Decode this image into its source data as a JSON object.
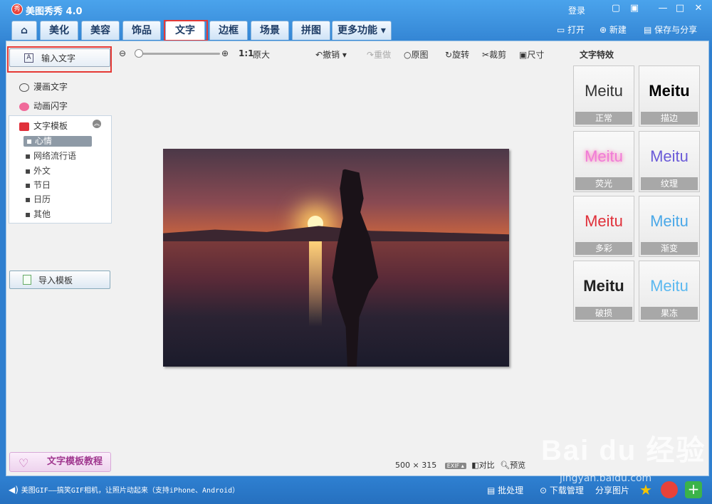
{
  "titlebar": {
    "app_title": "美图秀秀 4.0",
    "logo_glyph": "秀",
    "login": "登录",
    "msg_icon": "message-icon",
    "skin_icon": "skin-icon",
    "min_glyph": "—",
    "max_glyph": "□",
    "close_glyph": "✕"
  },
  "tabs": [
    "美化",
    "美容",
    "饰品",
    "文字",
    "边框",
    "场景",
    "拼图",
    "更多功能"
  ],
  "active_tab": "文字",
  "right_actions": {
    "open": "打开",
    "new": "新建",
    "save": "保存与分享"
  },
  "left_panel": {
    "input_text": "输入文字",
    "input_icon_glyph": "A",
    "comic_text": "漫画文字",
    "anim_text": "动画闪字",
    "template_header": "文字模板",
    "template_items": [
      "心情",
      "网络流行语",
      "外文",
      "节日",
      "日历",
      "其他"
    ],
    "import_template": "导入模板",
    "tutorial": "文字模板教程"
  },
  "toolbar": {
    "ratio": "1:1",
    "original_size": "原大",
    "undo": "撤销",
    "redo": "重做",
    "original": "原图",
    "rotate": "旋转",
    "crop": "裁剪",
    "size": "尺寸"
  },
  "effects": {
    "title": "文字特效",
    "sample_text": "Meitu",
    "items": [
      {
        "label": "正常",
        "color": "#333333"
      },
      {
        "label": "描边",
        "color": "#000000"
      },
      {
        "label": "荧光",
        "color": "#f07ad8"
      },
      {
        "label": "纹理",
        "color": "#6a5ad8"
      },
      {
        "label": "多彩",
        "color": "#e0303a"
      },
      {
        "label": "渐变",
        "color": "#4aa8e8"
      },
      {
        "label": "破损",
        "color": "#222222"
      },
      {
        "label": "果冻",
        "color": "#5ab8f0"
      }
    ]
  },
  "status": {
    "width": "500",
    "times": "×",
    "height": "315",
    "exif": "EXIF",
    "compare": "对比",
    "preview": "预览"
  },
  "bottombar": {
    "ticker": "美图GIF——搞笑GIF相机，让照片动起来（支持iPhone、Android）",
    "batch": "批处理",
    "download": "下载管理",
    "share": "分享图片"
  },
  "watermark": {
    "logo": "Bai du 经验",
    "url": "jingyan.baidu.com"
  }
}
